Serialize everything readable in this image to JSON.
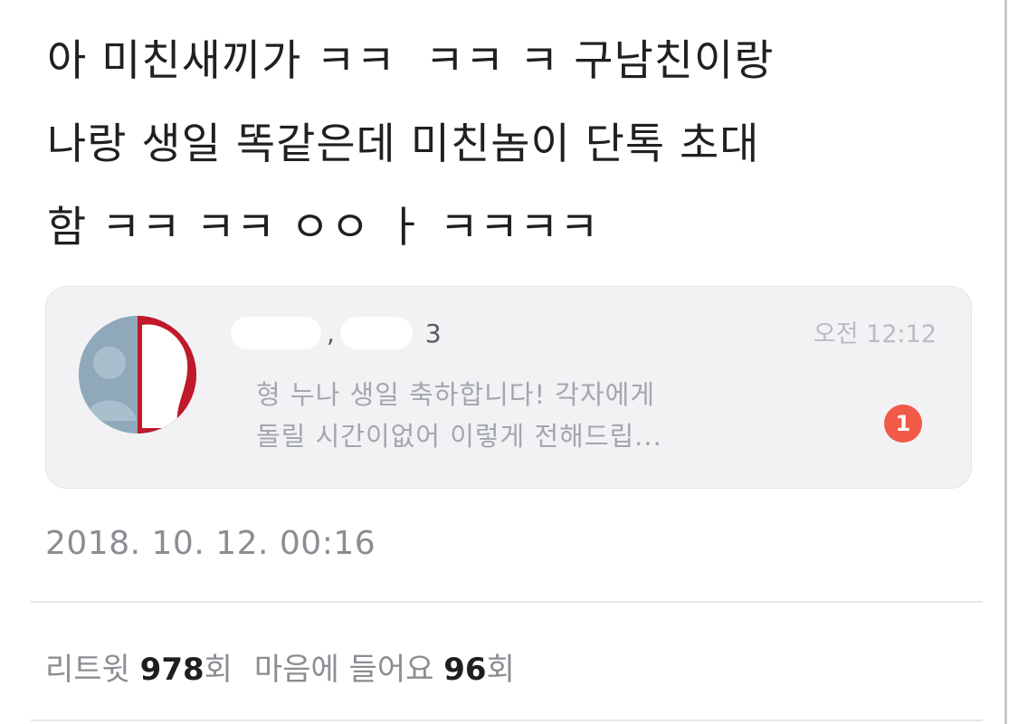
{
  "tweet": {
    "lines": [
      "아 미친새끼가 ㅋㅋ  ㅋㅋ ㅋ 구남친이랑",
      "나랑 생일 똑같은데 미친놈이 단톡 초대",
      "함 ㅋㅋ ㅋㅋ ㅇㅇ ㅏ ㅋㅋㅋㅋ"
    ],
    "timestamp": "2018. 10. 12. 00:16"
  },
  "notification": {
    "sender_fragment": ", ",
    "sender_suffix": "3",
    "time": "오전 12:12",
    "message_lines": [
      "형 누나 생일 축하합니다! 각자에게",
      "돌릴 시간이없어 이렇게 전해드립..."
    ],
    "unread_count": "1",
    "badge_color": "#f05a46"
  },
  "stats": {
    "retweet_label": "리트윗",
    "retweet_count": "978",
    "retweet_unit": "회",
    "likes_label": "마음에 들어요",
    "likes_count": "96",
    "likes_unit": "회"
  }
}
